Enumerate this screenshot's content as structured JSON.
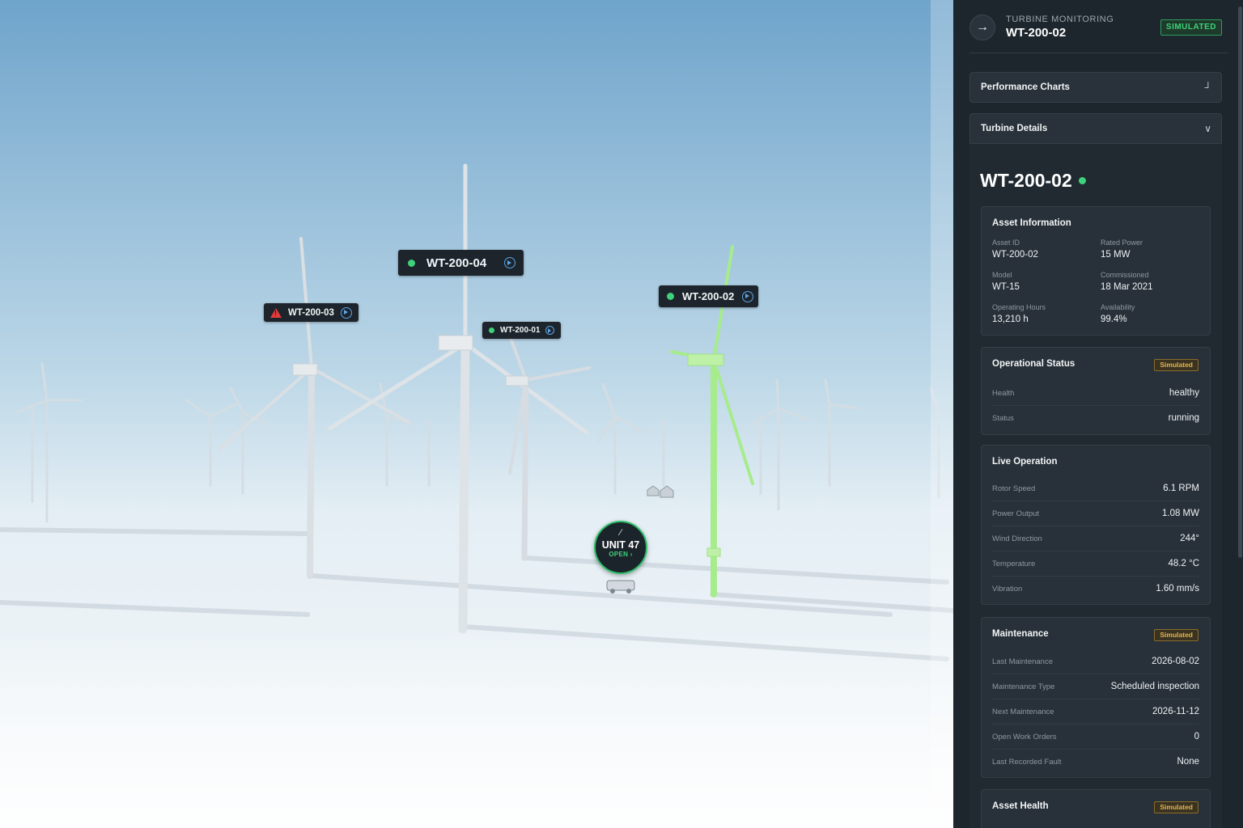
{
  "scene": {
    "tags": [
      {
        "id": "WT-200-04",
        "state": "ok"
      },
      {
        "id": "WT-200-03",
        "state": "alert"
      },
      {
        "id": "WT-200-01",
        "state": "ok"
      },
      {
        "id": "WT-200-02",
        "state": "ok"
      }
    ],
    "unit_marker": {
      "label": "UNIT 47",
      "status": "OPEN ›"
    },
    "colors": {
      "sky_top": "#7fb0d4",
      "ground": "#f2f6f9",
      "highlight": "#a6ec8c",
      "ok": "#3ed27a",
      "alert": "#e23b3b"
    }
  },
  "panel": {
    "header": {
      "kicker": "TURBINE MONITORING",
      "title": "WT-200-02",
      "badge": "SIMULATED",
      "back_icon": "arrow-right-icon"
    },
    "accordions": {
      "performance": {
        "label": "Performance Charts",
        "icon": "corner-icon"
      },
      "details": {
        "label": "Turbine Details",
        "icon": "chevron-down-icon"
      }
    },
    "turbine_title": "WT-200-02",
    "asset_info": {
      "title": "Asset Information",
      "fields": [
        {
          "label": "Asset ID",
          "value": "WT-200-02"
        },
        {
          "label": "Rated Power",
          "value": "15 MW"
        },
        {
          "label": "Model",
          "value": "WT-15"
        },
        {
          "label": "Commissioned",
          "value": "18 Mar 2021"
        },
        {
          "label": "Operating Hours",
          "value": "13,210 h"
        },
        {
          "label": "Availability",
          "value": "99.4%"
        }
      ]
    },
    "operational_status": {
      "title": "Operational Status",
      "badge": "Simulated",
      "rows": [
        {
          "label": "Health",
          "value": "healthy"
        },
        {
          "label": "Status",
          "value": "running"
        }
      ]
    },
    "live_operation": {
      "title": "Live Operation",
      "rows": [
        {
          "label": "Rotor Speed",
          "value": "6.1 RPM"
        },
        {
          "label": "Power Output",
          "value": "1.08 MW"
        },
        {
          "label": "Wind Direction",
          "value": "244°"
        },
        {
          "label": "Temperature",
          "value": "48.2 °C"
        },
        {
          "label": "Vibration",
          "value": "1.60 mm/s"
        }
      ]
    },
    "maintenance": {
      "title": "Maintenance",
      "badge": "Simulated",
      "rows": [
        {
          "label": "Last Maintenance",
          "value": "2026-08-02"
        },
        {
          "label": "Maintenance Type",
          "value": "Scheduled inspection"
        },
        {
          "label": "Next Maintenance",
          "value": "2026-11-12"
        },
        {
          "label": "Open Work Orders",
          "value": "0"
        },
        {
          "label": "Last Recorded Fault",
          "value": "None"
        }
      ]
    },
    "asset_health": {
      "title": "Asset Health",
      "badge": "Simulated"
    }
  }
}
